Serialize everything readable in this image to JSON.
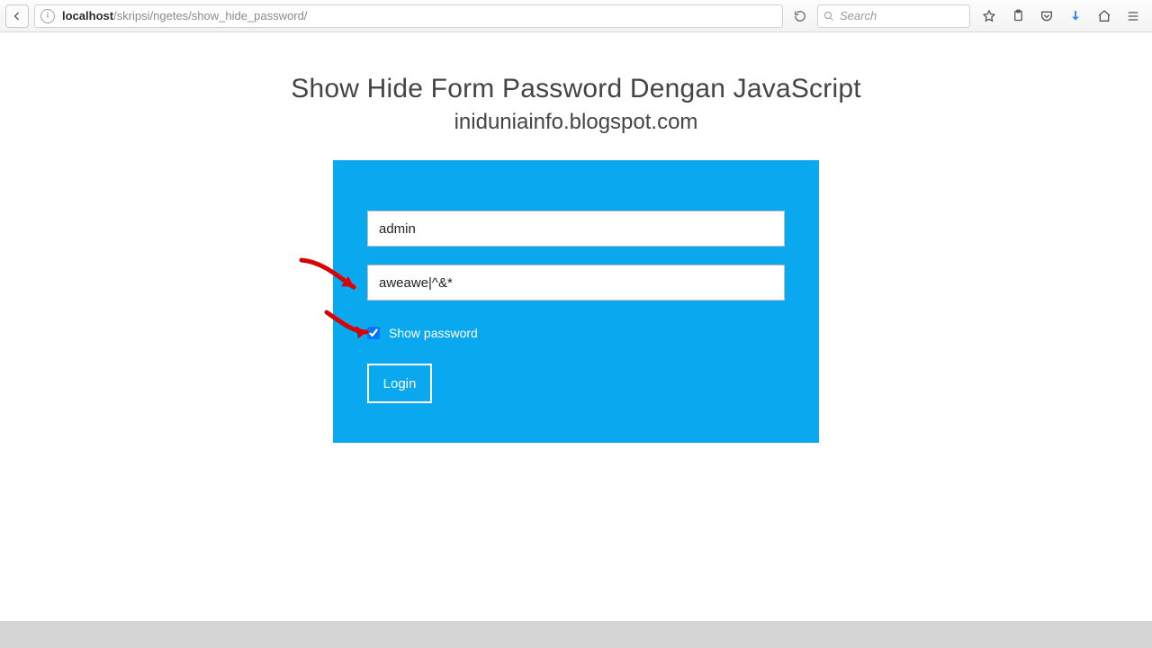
{
  "browser": {
    "url_host": "localhost",
    "url_path": "/skripsi/ngetes/show_hide_password/",
    "search_placeholder": "Search"
  },
  "page": {
    "title": "Show Hide Form Password Dengan JavaScript",
    "subtitle": "iniduniainfo.blogspot.com"
  },
  "form": {
    "username_value": "admin",
    "password_value": "aweawe|^&*",
    "show_password_label": "Show password",
    "show_password_checked": true,
    "login_label": "Login"
  }
}
